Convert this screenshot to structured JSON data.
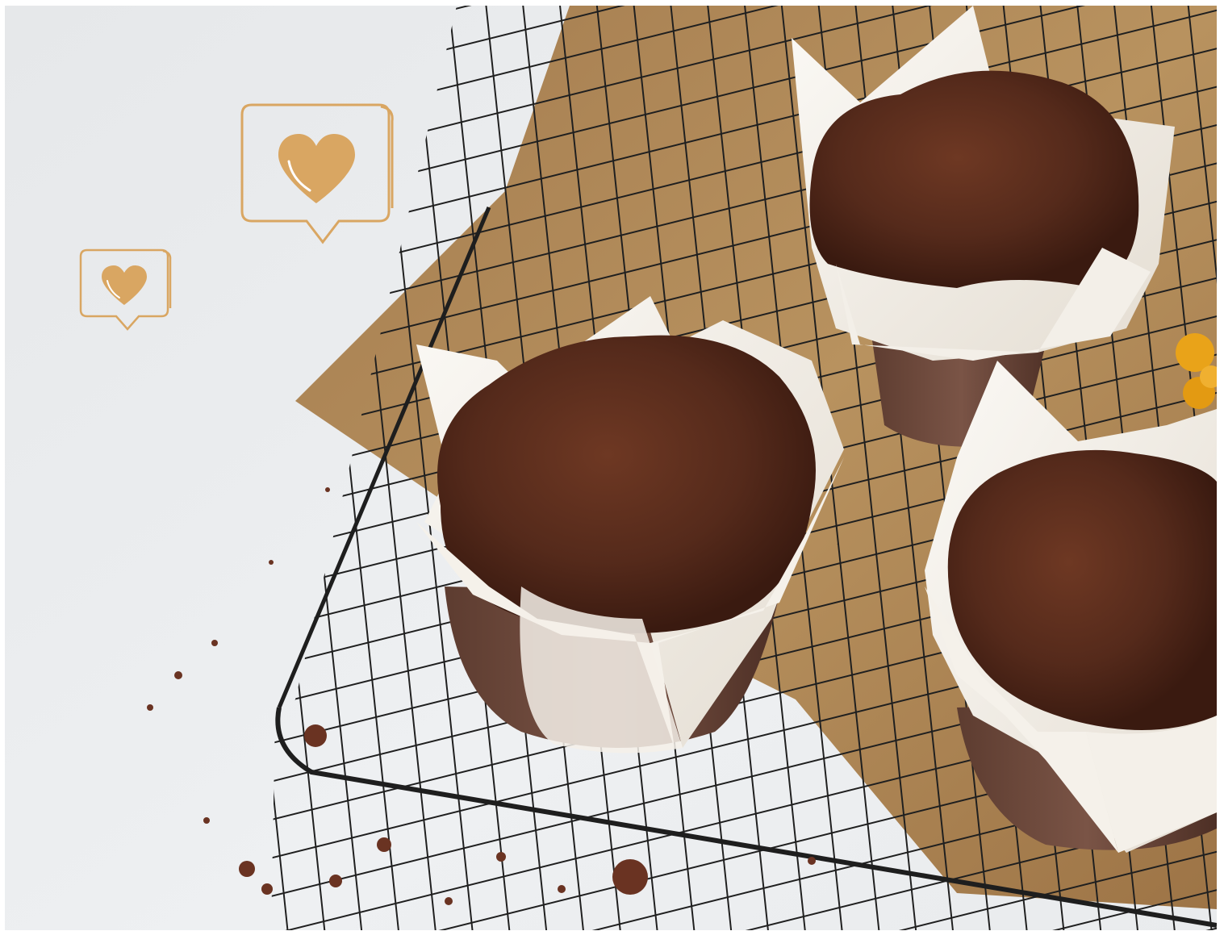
{
  "scene": {
    "subject": "chocolate-muffins-on-cooling-rack",
    "colors": {
      "background_surface": "#eceff1",
      "parchment": "#b08a5c",
      "rack_wire": "#1e1e1e",
      "muffin_top": "#5a2c1c",
      "muffin_shadow": "#3a1a10",
      "liner_white": "#f6f3ee",
      "liner_brown": "#6b4638",
      "berry": "#e9a319",
      "icon_accent": "#d9a662"
    }
  },
  "icons": [
    {
      "name": "like-notification-icon-large",
      "glyph": "heart-speech-bubble"
    },
    {
      "name": "like-notification-icon-small",
      "glyph": "heart-speech-bubble"
    }
  ]
}
